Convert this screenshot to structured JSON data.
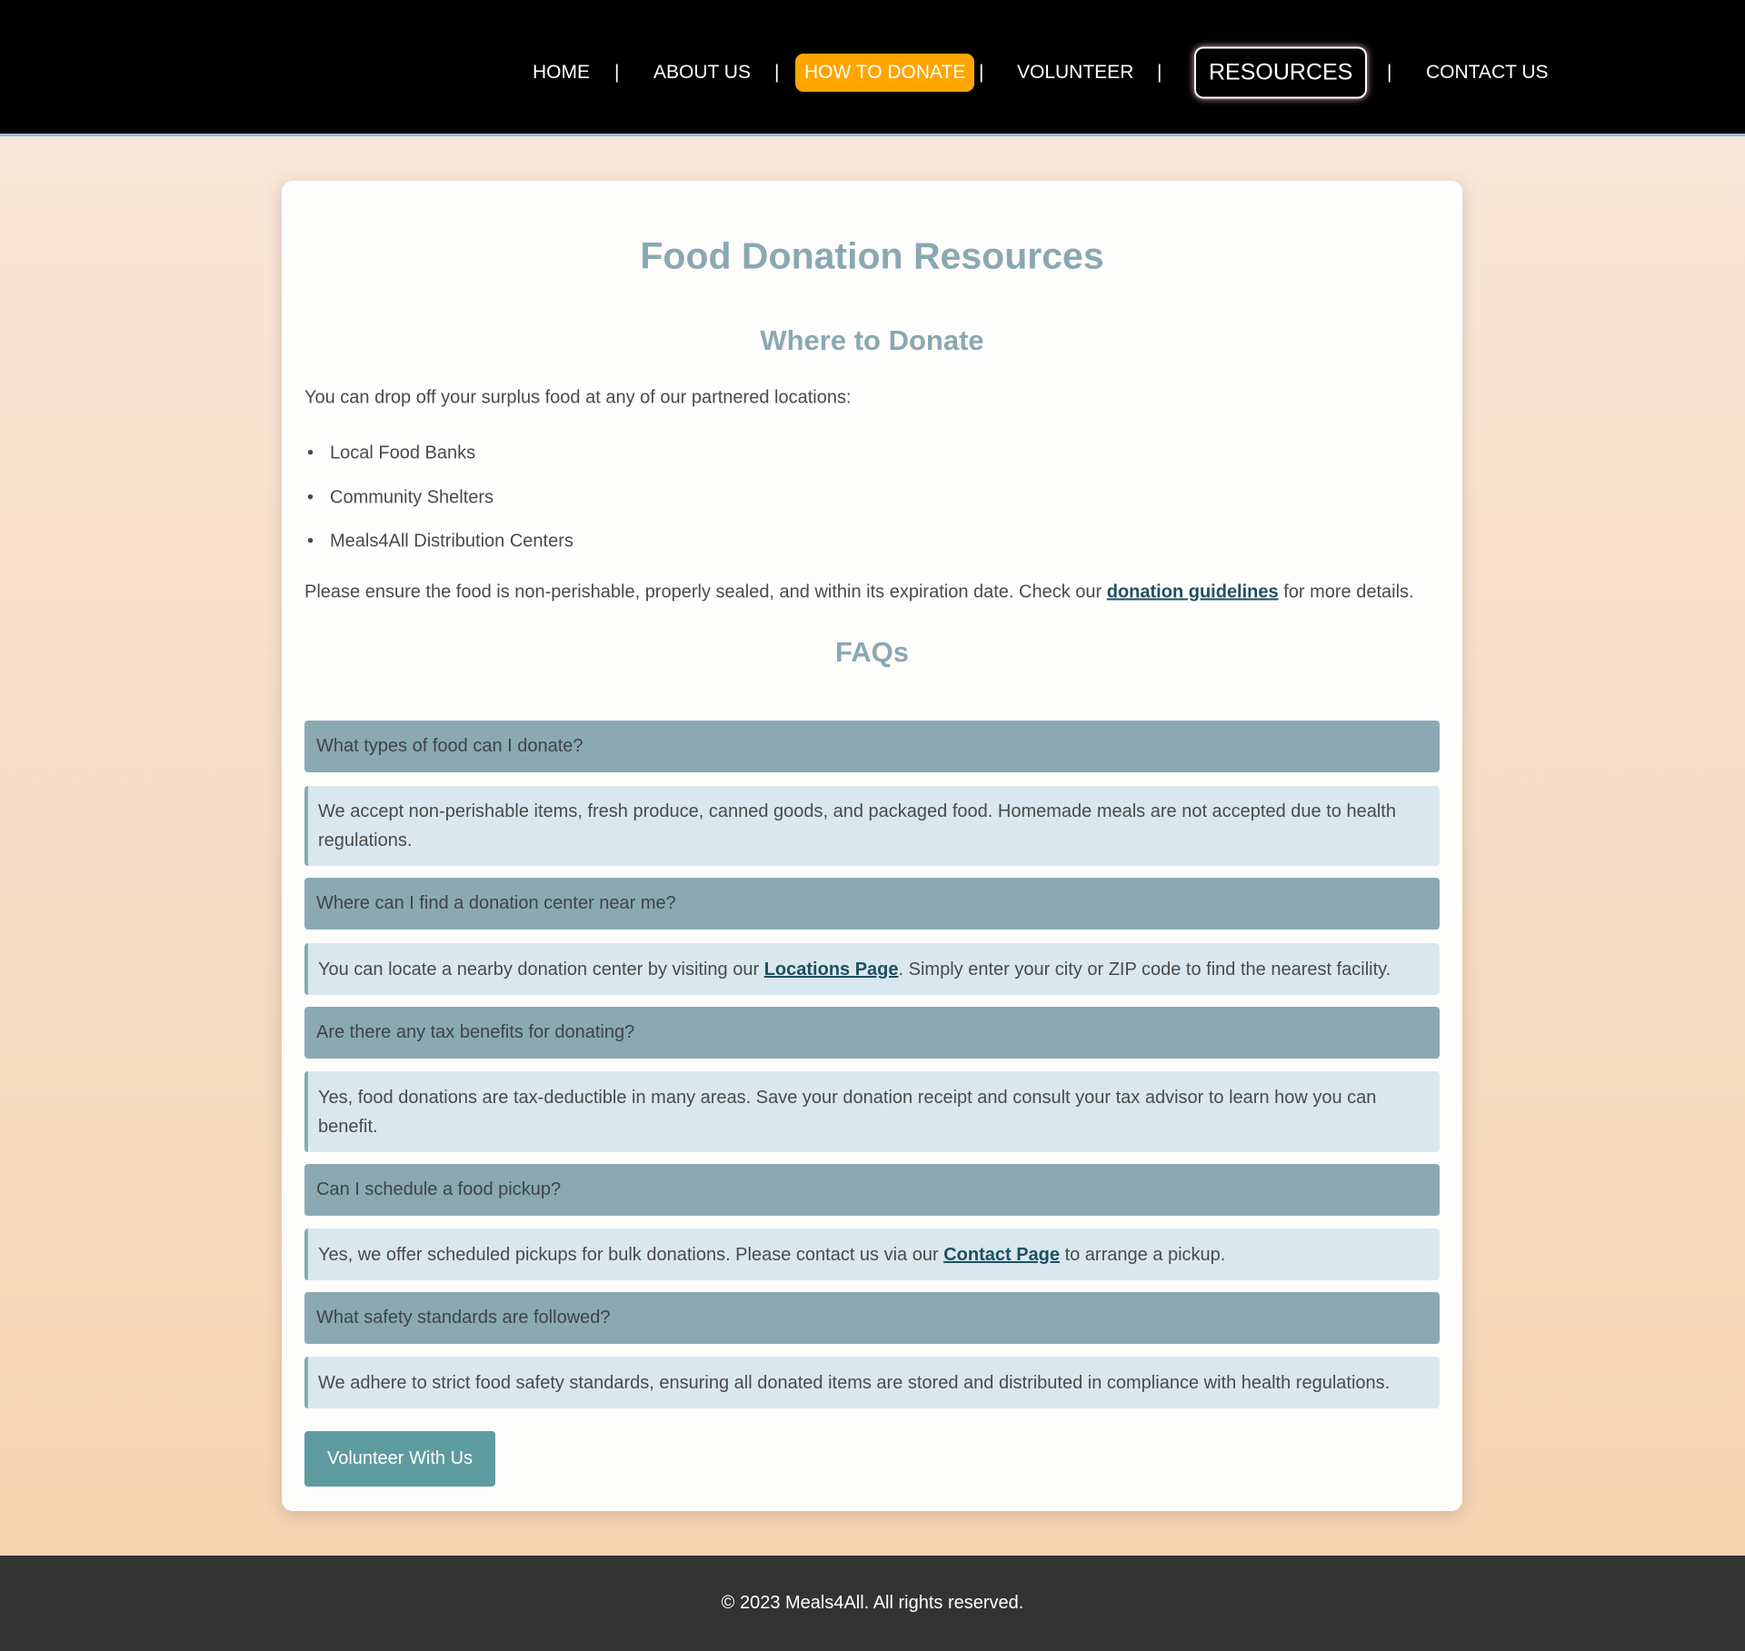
{
  "nav": {
    "home": "HOME",
    "about": "ABOUT US",
    "donate": "HOW TO DONATE",
    "volunteer": "VOLUNTEER",
    "resources": "RESOURCES",
    "contact": "CONTACT US",
    "separator": "|",
    "colors": {
      "donate_bg": "#ffa500",
      "bar_bg": "#000000"
    }
  },
  "main": {
    "title": "Food Donation Resources",
    "where": {
      "heading": "Where to Donate",
      "intro": "You can drop off your surplus food at any of our partnered locations:",
      "locations": [
        "Local Food Banks",
        "Community Shelters",
        "Meals4All Distribution Centers"
      ],
      "note_before": "Please ensure the food is non-perishable, properly sealed, and within its expiration date. Check our ",
      "note_link": "donation guidelines",
      "note_after": " for more details."
    },
    "faqs_heading": "FAQs",
    "faqs": [
      {
        "q": "What types of food can I donate?",
        "a_line1": "We accept non-perishable items, fresh produce, canned goods, and packaged food. Homemade meals are not accepted due to health",
        "a_line2": "regulations."
      },
      {
        "q": "Where can I find a donation center near me?",
        "a_before": "You can locate a nearby donation center by visiting our ",
        "a_link": "Locations Page",
        "a_after": ". Simply enter your city or ZIP code to find the nearest facility."
      },
      {
        "q": "Are there any tax benefits for donating?",
        "a_line1": "Yes, food donations are tax-deductible in many areas. Save your donation receipt and consult your tax advisor to learn how you can",
        "a_line2": "benefit."
      },
      {
        "q": "Can I schedule a food pickup?",
        "a_before": "Yes, we offer scheduled pickups for bulk donations. Please contact us via our ",
        "a_link": "Contact Page",
        "a_after": " to arrange a pickup."
      },
      {
        "q": "What safety standards are followed?",
        "a": "We adhere to strict food safety standards, ensuring all donated items are stored and distributed in compliance with health regulations."
      }
    ],
    "volunteer_button": "Volunteer With Us"
  },
  "footer": {
    "text": "© 2023 Meals4All. All rights reserved."
  }
}
